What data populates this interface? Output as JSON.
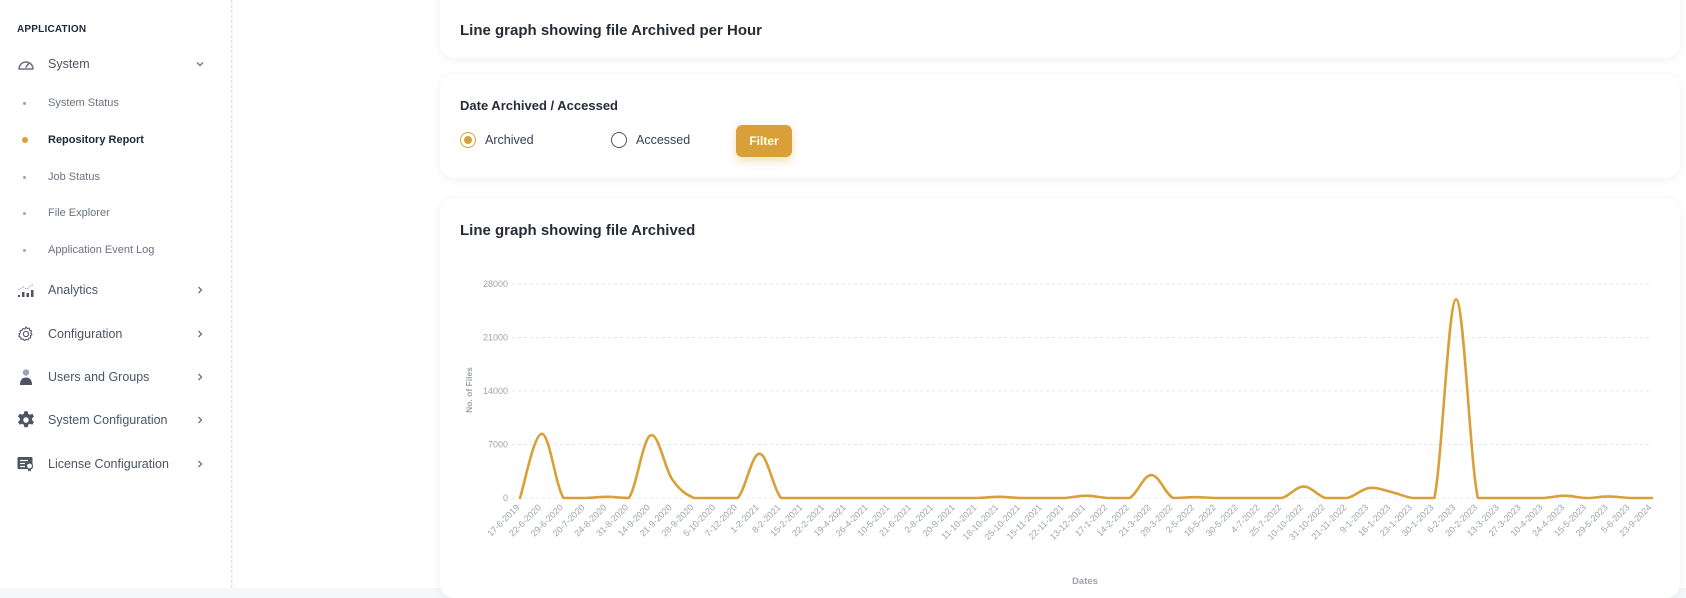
{
  "sidebar": {
    "section_title": "APPLICATION",
    "items": [
      {
        "label": "System",
        "icon": "gauge-icon",
        "expanded": true,
        "children": [
          {
            "label": "System Status",
            "active": false
          },
          {
            "label": "Repository Report",
            "active": true
          },
          {
            "label": "Job Status",
            "active": false
          },
          {
            "label": "File Explorer",
            "active": false
          },
          {
            "label": "Application Event Log",
            "active": false
          }
        ]
      },
      {
        "label": "Analytics",
        "icon": "analytics-chart-icon"
      },
      {
        "label": "Configuration",
        "icon": "gear-outline-icon"
      },
      {
        "label": "Users and Groups",
        "icon": "user-icon"
      },
      {
        "label": "System Configuration",
        "icon": "gear-filled-icon"
      },
      {
        "label": "License Configuration",
        "icon": "license-icon"
      }
    ]
  },
  "hourly_card": {
    "title": "Line graph showing file Archived per Hour"
  },
  "filter_card": {
    "title": "Date Archived / Accessed",
    "options": [
      {
        "label": "Archived",
        "checked": true
      },
      {
        "label": "Accessed",
        "checked": false
      }
    ],
    "button_label": "Filter"
  },
  "chart_card": {
    "title": "Line graph showing file Archived"
  },
  "colors": {
    "accent": "#d9a03a",
    "line": "#d9a03a",
    "text": "#262c36"
  },
  "chart_data": {
    "type": "line",
    "title": "Line graph showing file Archived",
    "xlabel": "Dates",
    "ylabel": "No. of Files",
    "ylim": [
      0,
      28000
    ],
    "yticks": [
      0,
      7000,
      14000,
      21000,
      28000
    ],
    "grid": true,
    "series": [
      {
        "name": "Archived",
        "color": "#d9a03a"
      }
    ],
    "x": [
      "17-6-2019",
      "22-6-2020",
      "29-6-2020",
      "20-7-2020",
      "24-8-2020",
      "31-8-2020",
      "14-9-2020",
      "21-9-2020",
      "28-9-2020",
      "5-10-2020",
      "7-12-2020",
      "1-2-2021",
      "8-2-2021",
      "15-2-2021",
      "22-2-2021",
      "19-4-2021",
      "26-4-2021",
      "10-5-2021",
      "21-6-2021",
      "2-8-2021",
      "20-9-2021",
      "11-10-2021",
      "18-10-2021",
      "25-10-2021",
      "15-11-2021",
      "22-11-2021",
      "13-12-2021",
      "17-1-2022",
      "14-2-2022",
      "21-3-2022",
      "28-3-2022",
      "2-5-2022",
      "16-5-2022",
      "30-5-2022",
      "4-7-2022",
      "25-7-2022",
      "10-10-2022",
      "31-10-2022",
      "21-11-2022",
      "9-1-2023",
      "16-1-2023",
      "23-1-2023",
      "30-1-2023",
      "6-2-2023",
      "20-2-2023",
      "13-3-2023",
      "27-3-2023",
      "10-4-2023",
      "24-4-2023",
      "15-5-2023",
      "29-5-2023",
      "5-6-2023",
      "23-9-2024"
    ],
    "values": [
      0,
      8400,
      0,
      0,
      150,
      0,
      8200,
      2400,
      0,
      0,
      0,
      5800,
      0,
      0,
      0,
      0,
      0,
      0,
      0,
      0,
      0,
      0,
      150,
      0,
      0,
      0,
      300,
      0,
      0,
      3000,
      0,
      100,
      0,
      0,
      0,
      0,
      1500,
      0,
      0,
      1300,
      800,
      0,
      0,
      26000,
      0,
      0,
      0,
      0,
      300,
      0,
      200,
      0,
      0
    ]
  }
}
